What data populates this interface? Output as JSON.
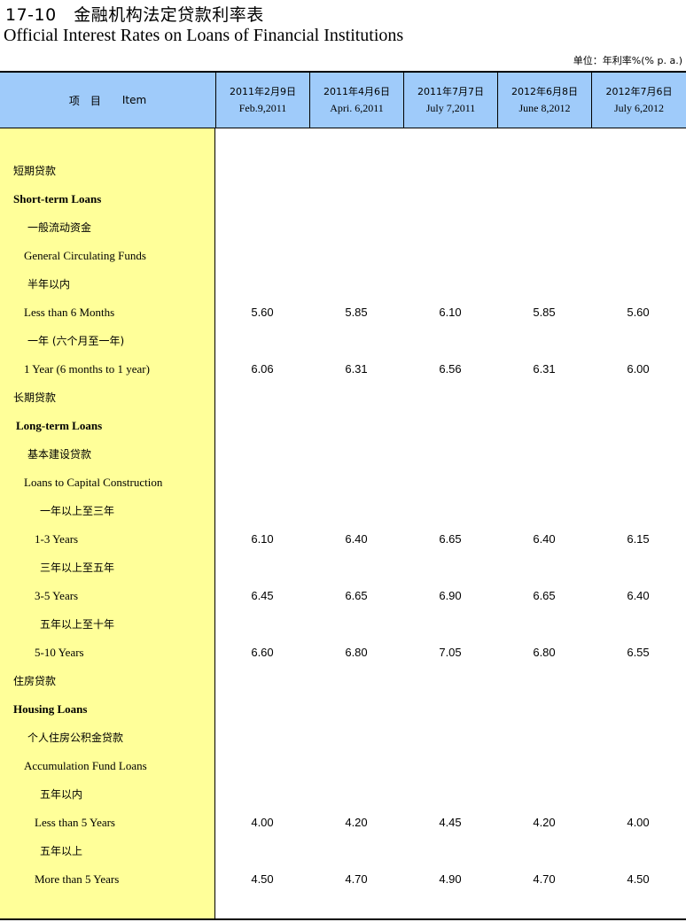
{
  "title_cn": "17-10　金融机构法定贷款利率表",
  "title_en": "Official Interest Rates on Loans of Financial Institutions",
  "unit": "单位：年利率%(% p. a.)",
  "header": {
    "item_cn": "项　目",
    "item_en": "Item",
    "columns": [
      {
        "cn": "2011年2月9日",
        "en": "Feb.9,2011"
      },
      {
        "cn": "2011年4月6日",
        "en": "Apri. 6,2011"
      },
      {
        "cn": "2011年7月7日",
        "en": "July 7,2011"
      },
      {
        "cn": "2012年6月8日",
        "en": "June 8,2012"
      },
      {
        "cn": "2012年7月6日",
        "en": "July 6,2012"
      }
    ]
  },
  "rows": [
    {
      "label": "短期贷款",
      "lang": "cn",
      "bold": false,
      "indent": 0,
      "values": []
    },
    {
      "label": "Short-term Loans",
      "lang": "en",
      "bold": true,
      "indent": 0,
      "values": []
    },
    {
      "label": "一般流动资金",
      "lang": "cn",
      "bold": false,
      "indent": 2,
      "values": []
    },
    {
      "label": "General Circulating Funds",
      "lang": "en",
      "bold": false,
      "indent": 1,
      "values": []
    },
    {
      "label": "半年以内",
      "lang": "cn",
      "bold": false,
      "indent": 2,
      "values": []
    },
    {
      "label": "Less than 6 Months",
      "lang": "en",
      "bold": false,
      "indent": 1,
      "values": [
        "5.60",
        "5.85",
        "6.10",
        "5.85",
        "5.60"
      ]
    },
    {
      "label": "一年 (六个月至一年)",
      "lang": "cn",
      "bold": false,
      "indent": 2,
      "values": []
    },
    {
      "label": "1 Year (6 months to 1 year)",
      "lang": "en",
      "bold": false,
      "indent": 1,
      "values": [
        "6.06",
        "6.31",
        "6.56",
        "6.31",
        "6.00"
      ]
    },
    {
      "label": "长期贷款",
      "lang": "cn",
      "bold": false,
      "indent": 0,
      "values": []
    },
    {
      "label": "Long-term Loans",
      "lang": "en",
      "bold": true,
      "indent": 0,
      "values": []
    },
    {
      "label": "基本建设贷款",
      "lang": "cn",
      "bold": false,
      "indent": 2,
      "values": []
    },
    {
      "label": "Loans to Capital Construction",
      "lang": "en",
      "bold": false,
      "indent": 1,
      "values": []
    },
    {
      "label": "一年以上至三年",
      "lang": "cn",
      "bold": false,
      "indent": 4,
      "values": []
    },
    {
      "label": "1-3 Years",
      "lang": "en",
      "bold": false,
      "indent": 3,
      "values": [
        "6.10",
        "6.40",
        "6.65",
        "6.40",
        "6.15"
      ]
    },
    {
      "label": "三年以上至五年",
      "lang": "cn",
      "bold": false,
      "indent": 4,
      "values": []
    },
    {
      "label": "3-5 Years",
      "lang": "en",
      "bold": false,
      "indent": 3,
      "values": [
        "6.45",
        "6.65",
        "6.90",
        "6.65",
        "6.40"
      ]
    },
    {
      "label": "五年以上至十年",
      "lang": "cn",
      "bold": false,
      "indent": 4,
      "values": []
    },
    {
      "label": "5-10 Years",
      "lang": "en",
      "bold": false,
      "indent": 3,
      "values": [
        "6.60",
        "6.80",
        "7.05",
        "6.80",
        "6.55"
      ]
    },
    {
      "label": "住房贷款",
      "lang": "cn",
      "bold": false,
      "indent": 0,
      "values": []
    },
    {
      "label": "Housing Loans",
      "lang": "en",
      "bold": true,
      "indent": 0,
      "values": []
    },
    {
      "label": "个人住房公积金贷款",
      "lang": "cn",
      "bold": false,
      "indent": 2,
      "values": []
    },
    {
      "label": "Accumulation Fund Loans",
      "lang": "en",
      "bold": false,
      "indent": 1,
      "values": []
    },
    {
      "label": "五年以内",
      "lang": "cn",
      "bold": false,
      "indent": 4,
      "values": []
    },
    {
      "label": "Less than 5 Years",
      "lang": "en",
      "bold": false,
      "indent": 3,
      "values": [
        "4.00",
        "4.20",
        "4.45",
        "4.20",
        "4.00"
      ]
    },
    {
      "label": "五年以上",
      "lang": "cn",
      "bold": false,
      "indent": 4,
      "values": []
    },
    {
      "label": "More than 5 Years",
      "lang": "en",
      "bold": false,
      "indent": 3,
      "values": [
        "4.50",
        "4.70",
        "4.90",
        "4.70",
        "4.50"
      ]
    }
  ]
}
